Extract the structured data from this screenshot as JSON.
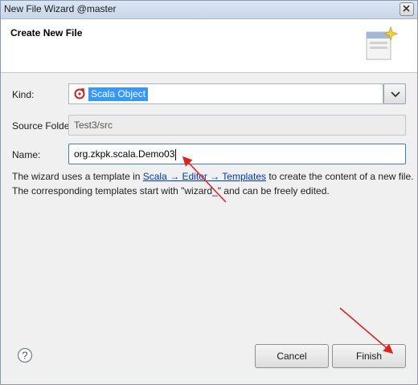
{
  "window": {
    "title": "New File Wizard @master"
  },
  "header": {
    "title": "Create New File",
    "icon": "new-file-wizard-icon"
  },
  "form": {
    "kind_label": "Kind:",
    "kind_value": "Scala Object",
    "source_folder_label": "Source Folder:",
    "source_folder_value": "Test3/src",
    "name_label": "Name:",
    "name_value": "org.zkpk.scala.Demo03"
  },
  "info": {
    "line1_pre": "The wizard uses a template in ",
    "link_scala": "Scala",
    "link_editor": "Editor",
    "link_templates": "Templates",
    "arrow": "→",
    "line1_post": " to create the content of a new file.",
    "line2": "The corresponding templates start with \"wizard_\" and can be freely edited."
  },
  "buttons": {
    "cancel": "Cancel",
    "finish": "Finish"
  },
  "colors": {
    "selection": "#3399ff",
    "link": "#0033cc",
    "annotation_arrow": "#e0221f"
  }
}
